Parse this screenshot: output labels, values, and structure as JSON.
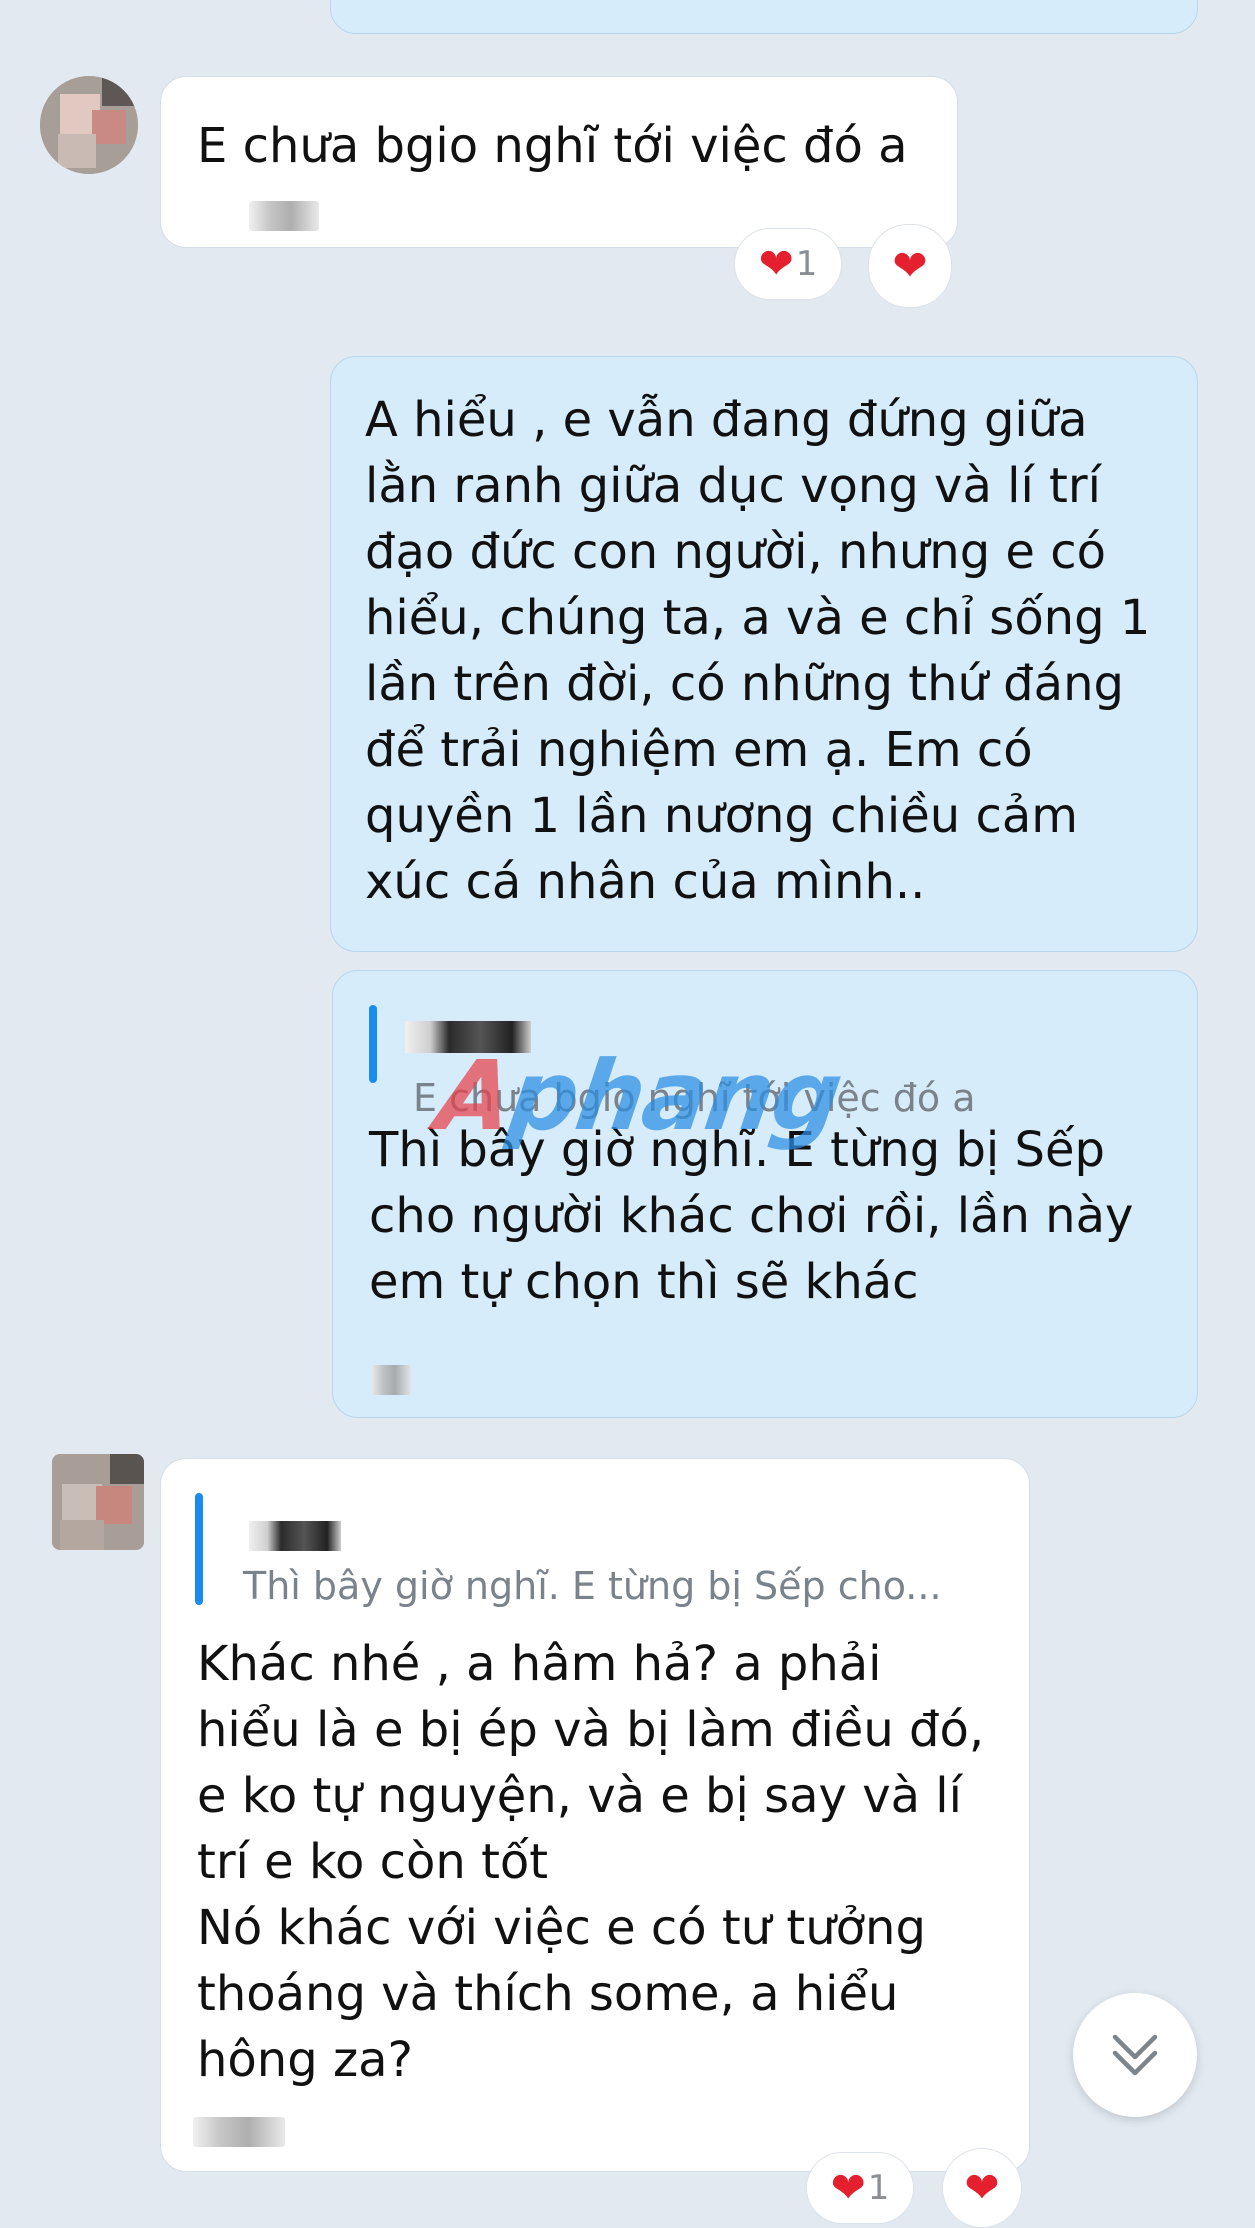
{
  "watermark": {
    "brand": "Aphang",
    "colors": {
      "first_letter": "#e8424a",
      "rest": "#2b8fe4"
    }
  },
  "messages": [
    {
      "id": "m1",
      "direction": "incoming",
      "text": "E chưa bgio nghĩ tới việc đó a",
      "reactions": {
        "heart_count": "1"
      }
    },
    {
      "id": "m2",
      "direction": "outgoing",
      "text": "A hiểu , e vẫn đang đứng giữa\nlằn ranh giữa dục vọng và lí trí\nđạo đức con người, nhưng e có\nhiểu, chúng ta, a và e chỉ sống 1\nlần trên đời, có những thứ đáng\nđể trải nghiệm em ạ. Em có\nquyền 1 lần nương chiều cảm\nxúc cá nhân của mình.."
    },
    {
      "id": "m3",
      "direction": "outgoing",
      "quote": {
        "text": "E chưa bgio nghĩ tới việc đó a"
      },
      "text": "Thì bây giờ nghĩ. E từng bị Sếp\ncho người khác chơi rồi, lần này\nem tự chọn thì sẽ khác"
    },
    {
      "id": "m4",
      "direction": "incoming",
      "quote": {
        "text": "Thì bây giờ nghĩ. E từng bị Sếp cho..."
      },
      "text": "Khác nhé , a hâm hả? a phải\nhiểu là e bị ép và bị làm điều đó,\ne ko tự nguyện, và e bị say và lí\ntrí e ko còn tốt\nNó khác với việc e có tư tưởng\nthoáng và thích some, a hiểu\nhông za?",
      "reactions": {
        "heart_count": "1"
      }
    }
  ],
  "icons": {
    "reaction": "heart-icon",
    "scroll": "chevron-double-down-icon"
  },
  "colors": {
    "background": "#e2e9f1",
    "incoming_bubble": "#ffffff",
    "outgoing_bubble": "#d6ecfb",
    "quote_bar": "#1a8cf0",
    "heart": "#e5202e"
  }
}
